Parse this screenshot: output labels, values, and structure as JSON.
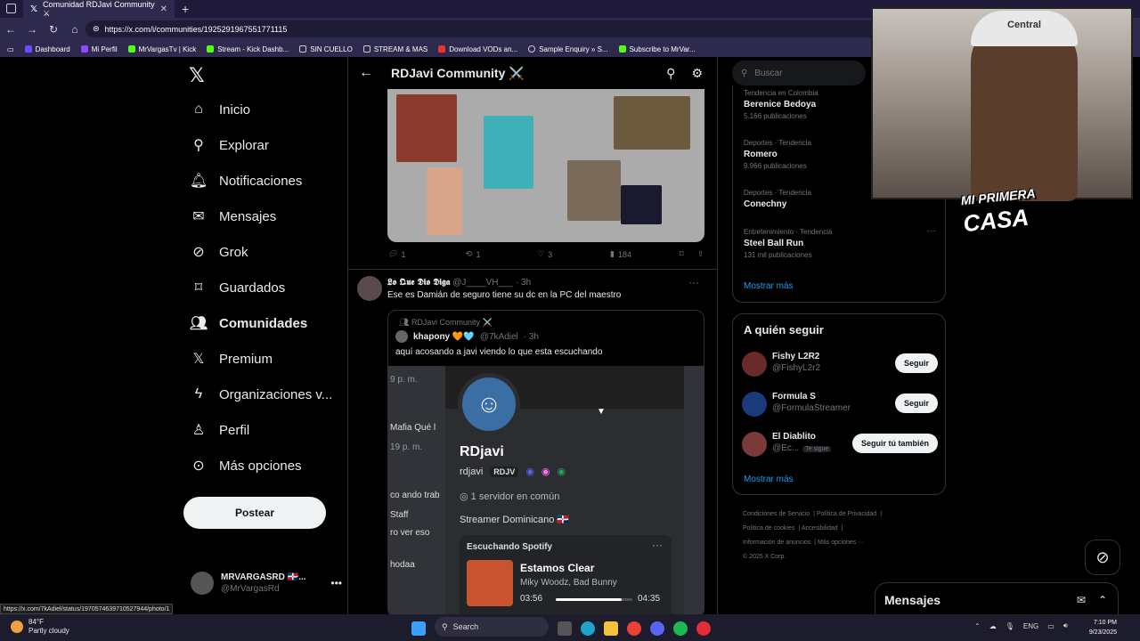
{
  "browser": {
    "tab_title": "Comunidad RDJavi Community ⚔",
    "url": "https://x.com/i/communities/1925291967551771115",
    "bookmarks": [
      "Dashboard",
      "Mi Perfil",
      "MrVargasTv | Kick",
      "Stream - Kick Dashb...",
      "SIN CUELLO",
      "STREAM & MAS",
      "Download VODs an...",
      "Sample Enquiry » S...",
      "Subscribe to MrVar..."
    ],
    "status_url": "https://x.com/7kAdiel/status/1970574639710527944/photo/1"
  },
  "nav": {
    "items": [
      {
        "label": "Inicio",
        "icon": "home-icon"
      },
      {
        "label": "Explorar",
        "icon": "search-icon"
      },
      {
        "label": "Notificaciones",
        "icon": "bell-icon"
      },
      {
        "label": "Mensajes",
        "icon": "mail-icon"
      },
      {
        "label": "Grok",
        "icon": "grok-icon"
      },
      {
        "label": "Guardados",
        "icon": "bookmark-icon"
      },
      {
        "label": "Comunidades",
        "icon": "communities-icon"
      },
      {
        "label": "Premium",
        "icon": "x-icon"
      },
      {
        "label": "Organizaciones v...",
        "icon": "lightning-icon"
      },
      {
        "label": "Perfil",
        "icon": "person-icon"
      },
      {
        "label": "Más opciones",
        "icon": "more-circle-icon"
      }
    ],
    "post_button": "Postear",
    "account": {
      "name": "MRVARGASRD 🇩🇴...",
      "handle": "@MrVargasRd"
    }
  },
  "community": {
    "title": "RDJavi Community ⚔️",
    "post1_stats": {
      "replies": "1",
      "reposts": "1",
      "likes": "3",
      "views": "184"
    },
    "post2": {
      "author": "𝕷𝖔 𝕼𝖚𝖊 𝕯𝖎𝖔 𝕯𝖎𝖌𝖆",
      "handle": "@J____VH___",
      "time": "· 3h",
      "text": "Ese es Damián de seguro tiene su dc en la PC del maestro",
      "quote": {
        "community": "RDJavi Community ⚔️",
        "author": "khapony 🧡🩵",
        "handle": "@7kAdiel",
        "time": "· 3h",
        "text": "aquí acosando a javi viendo lo que esta escuchando"
      }
    }
  },
  "discord": {
    "side": [
      "9 p. m.",
      "Mafia  Qué l",
      "19 p. m.",
      "co ando trab",
      "Staff",
      "ro ver eso",
      "hodaa"
    ],
    "name": "RDjavi",
    "username": "rdjavi",
    "tag": "RDJV",
    "servers": "1 servidor en común",
    "bio": "Streamer Dominicano 🇩🇴",
    "spotify_label": "Escuchando Spotify",
    "song": "Estamos Clear",
    "artist": "Miky Woodz, Bad Bunny",
    "elapsed": "03:56",
    "duration": "04:35",
    "progress": 0.86
  },
  "right": {
    "search_placeholder": "Buscar",
    "trends": [
      {
        "category": "Tendencia en Colombia",
        "name": "Berenice Bedoya",
        "count": "5.166 publicaciones"
      },
      {
        "category": "Deportes · Tendencia",
        "name": "Romero",
        "count": "9.966 publicaciones"
      },
      {
        "category": "Deportes · Tendencia",
        "name": "Conechny",
        "count": ""
      },
      {
        "category": "Entretenimiento · Tendencia",
        "name": "Steel Ball Run",
        "count": "131 mil publicaciones"
      }
    ],
    "show_more": "Mostrar más",
    "who_to_follow_title": "A quién seguir",
    "follow": [
      {
        "name": "Fishy L2R2",
        "handle": "@FishyL2r2",
        "button": "Seguir"
      },
      {
        "name": "Formula S",
        "handle": "@FormulaStreamer",
        "button": "Seguir"
      },
      {
        "name": "El Diablito",
        "handle": "@Ec...",
        "badge": "Te sigue",
        "button": "Seguir tú también"
      }
    ],
    "show_more2": "Mostrar más",
    "footer": [
      "Condiciones de Servicio",
      "Política de Privacidad",
      "Política de cookies",
      "Accesibilidad",
      "Información de anuncios",
      "Más opciones ···",
      "© 2025 X Corp."
    ]
  },
  "overlay": {
    "cap_text": "Central",
    "logo_line1": "MI PRIMERA",
    "logo_line2": "CASA"
  },
  "messages_drawer": "Mensajes",
  "taskbar": {
    "temp": "84°F",
    "weather": "Partly cloudy",
    "search": "Search",
    "lang": "ENG",
    "time": "7:10 PM",
    "date": "9/23/2025"
  }
}
